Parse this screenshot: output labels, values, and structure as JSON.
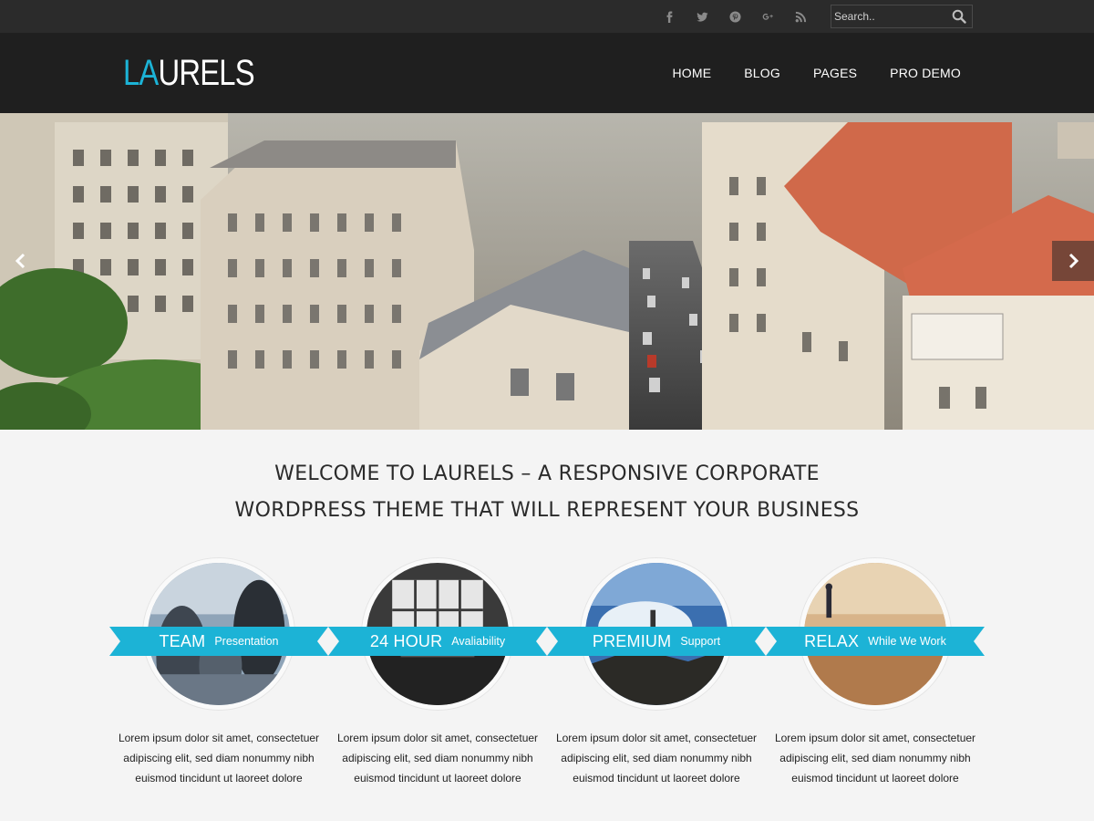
{
  "topbar": {
    "social_icons": [
      "facebook-icon",
      "twitter-icon",
      "pinterest-icon",
      "google-plus-icon",
      "rss-icon"
    ],
    "search": {
      "placeholder": "Search..",
      "value": ""
    }
  },
  "header": {
    "logo": {
      "accent": "LA",
      "rest": "URELS",
      "accent_color": "#1cb3d6"
    },
    "nav": [
      "HOME",
      "BLOG",
      "PAGES",
      "PRO DEMO"
    ]
  },
  "hero": {
    "prev_icon": "chevron-left-icon",
    "next_icon": "chevron-right-icon"
  },
  "welcome": {
    "line1": "WELCOME TO LAURELS – A RESPONSIVE CORPORATE",
    "line2": "WORDPRESS THEME THAT WILL REPRESENT YOUR BUSINESS"
  },
  "features": [
    {
      "title": "TEAM",
      "subtitle": "Presentation",
      "text": "Lorem ipsum dolor sit amet, consectetuer adipiscing elit, sed diam nonummy nibh euismod tincidunt ut laoreet dolore"
    },
    {
      "title": "24 HOUR",
      "subtitle": "Avaliability",
      "text": "Lorem ipsum dolor sit amet, consectetuer adipiscing elit, sed diam nonummy nibh euismod tincidunt ut laoreet dolore"
    },
    {
      "title": "PREMIUM",
      "subtitle": "Support",
      "text": "Lorem ipsum dolor sit amet, consectetuer adipiscing elit, sed diam nonummy nibh euismod tincidunt ut laoreet dolore"
    },
    {
      "title": "RELAX",
      "subtitle": "While We Work",
      "text": "Lorem ipsum dolor sit amet, consectetuer adipiscing elit, sed diam nonummy nibh euismod tincidunt ut laoreet dolore"
    }
  ],
  "colors": {
    "accent": "#1cb3d6",
    "topbar": "#2b2b2b",
    "header": "#1f1f1f",
    "body": "#f4f4f4"
  }
}
